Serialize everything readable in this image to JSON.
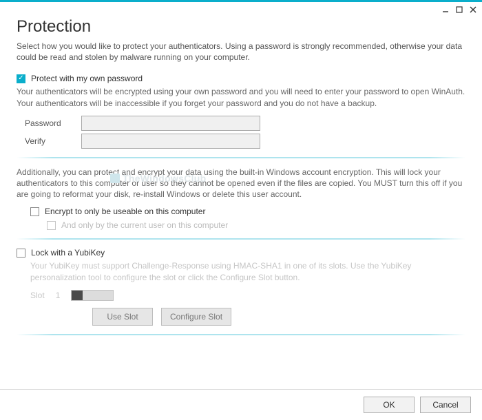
{
  "title": "Protection",
  "intro": "Select how you would like to protect your authenticators. Using a password is strongly recommended, otherwise your data could be read and stolen by malware running on your computer.",
  "pwd": {
    "option_label": "Protect with my own password",
    "checked": true,
    "desc": "Your authenticators will be encrypted using your own password and you will need to enter your password to open WinAuth. Your authenticators will be inaccessible if you forget your password and you do not have a backup.",
    "password_label": "Password",
    "password_value": "",
    "verify_label": "Verify",
    "verify_value": ""
  },
  "encrypt": {
    "desc": "Additionally, you can protect and encrypt your data using the built-in Windows account encryption. This will lock your authenticators to this computer or user so they cannot be opened even if the files are copied. You MUST turn this off if you are going to reformat your disk, re-install Windows or delete this user account.",
    "computer_label": "Encrypt to only be useable on this computer",
    "computer_checked": false,
    "user_label": "And only by the current user on this computer",
    "user_checked": false
  },
  "yubi": {
    "option_label": "Lock with a YubiKey",
    "checked": false,
    "desc": "Your YubiKey must support Challenge-Response using HMAC-SHA1 in one of its slots. Use the YubiKey personalization tool to configure the slot or click the Configure Slot button.",
    "slot_label": "Slot",
    "slot_value": "1",
    "use_slot_label": "Use Slot",
    "configure_slot_label": "Configure Slot"
  },
  "footer": {
    "ok_label": "OK",
    "cancel_label": "Cancel"
  },
  "watermark": "TheWindowsClub"
}
